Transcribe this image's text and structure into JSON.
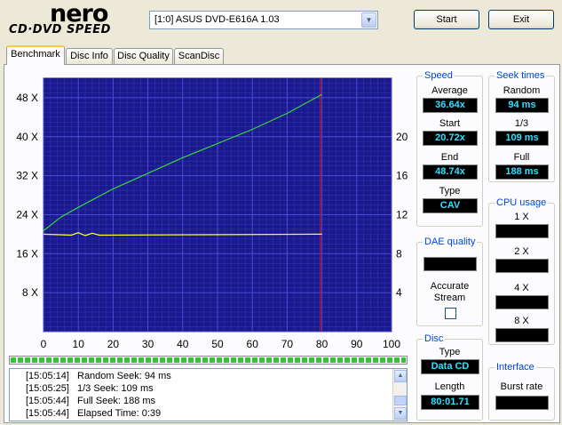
{
  "header": {
    "logo_text": "nero",
    "logo_sub": "CD·DVD SPEED",
    "drive": "[1:0]  ASUS DVD-E616A 1.03",
    "start_label": "Start",
    "exit_label": "Exit"
  },
  "tabs": [
    "Benchmark",
    "Disc Info",
    "Disc Quality",
    "ScanDisc"
  ],
  "chart_data": {
    "type": "line",
    "x_ticks": [
      "0",
      "10",
      "20",
      "30",
      "40",
      "50",
      "60",
      "70",
      "80",
      "90",
      "100"
    ],
    "y_left_ticks": [
      "48 X",
      "40 X",
      "32 X",
      "24 X",
      "16 X",
      "8 X"
    ],
    "y_right_ticks": [
      "20",
      "16",
      "12",
      "8",
      "4"
    ],
    "xlim": [
      0,
      100
    ],
    "ylim_left": [
      0,
      52
    ],
    "ylim_right": [
      0,
      26
    ],
    "series": [
      {
        "color": "#3ad63a",
        "x": [
          0,
          5,
          10,
          20,
          30,
          40,
          50,
          60,
          70,
          80
        ],
        "y": [
          20.7,
          23.5,
          25.5,
          29.3,
          32.5,
          35.7,
          38.6,
          41.5,
          44.8,
          48.7
        ]
      },
      {
        "color": "#ffff30",
        "x": [
          0,
          8,
          10,
          12,
          14,
          16,
          80
        ],
        "y": [
          20.0,
          19.8,
          20.3,
          19.7,
          20.2,
          19.8,
          20.0
        ]
      }
    ],
    "marker_x": 79.5,
    "colors": {
      "bg": "#1a1a8c",
      "grid": "#3030b0",
      "marker": "#c01818"
    }
  },
  "progress": {
    "value": 1.0
  },
  "log": [
    {
      "time": "[15:05:14]",
      "text": "Random Seek: 94 ms"
    },
    {
      "time": "[15:05:25]",
      "text": "1/3 Seek: 109 ms"
    },
    {
      "time": "[15:05:44]",
      "text": "Full Seek: 188 ms"
    },
    {
      "time": "[15:05:44]",
      "text": "Elapsed Time:  0:39"
    }
  ],
  "speed": {
    "title": "Speed",
    "average_label": "Average",
    "average": "36.64x",
    "start_label": "Start",
    "start": "20.72x",
    "end_label": "End",
    "end": "48.74x",
    "type_label": "Type",
    "type": "CAV"
  },
  "seek": {
    "title": "Seek times",
    "random_label": "Random",
    "random": "94 ms",
    "third_label": "1/3",
    "third": "109 ms",
    "full_label": "Full",
    "full": "188 ms"
  },
  "cpu": {
    "title": "CPU usage",
    "labels": [
      "1 X",
      "2 X",
      "4 X",
      "8 X"
    ]
  },
  "dae": {
    "title": "DAE quality",
    "accurate_label_1": "Accurate",
    "accurate_label_2": "Stream"
  },
  "disc": {
    "title": "Disc",
    "type_label": "Type",
    "type": "Data CD",
    "length_label": "Length",
    "length": "80:01.71"
  },
  "interface": {
    "title": "Interface",
    "burst_label": "Burst rate"
  }
}
